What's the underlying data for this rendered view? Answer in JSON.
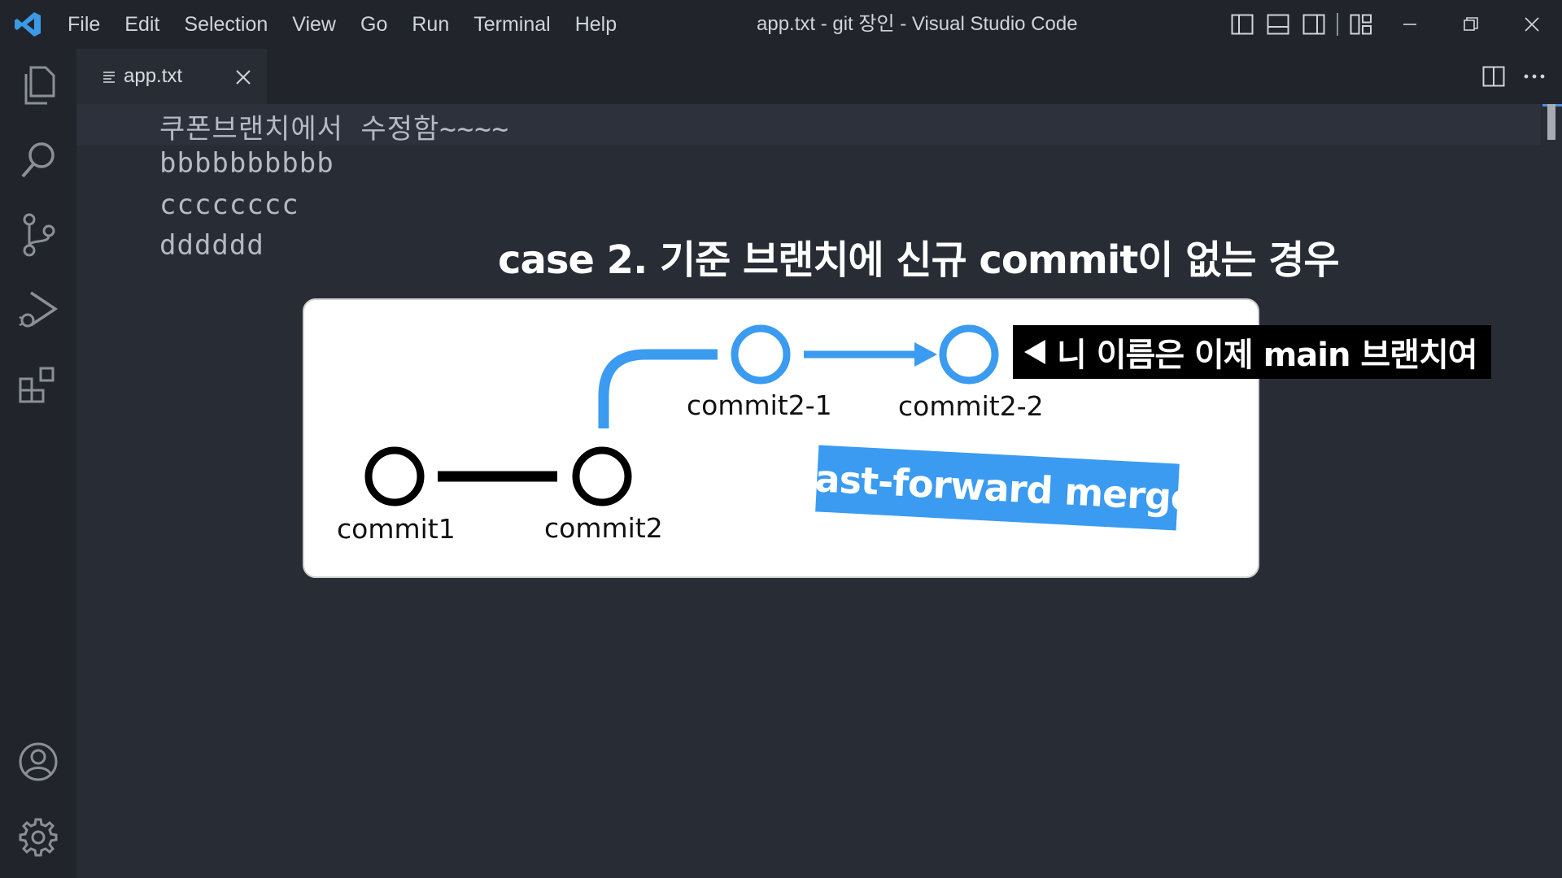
{
  "window": {
    "title": "app.txt - git 장인 - Visual Studio Code",
    "menu": [
      "File",
      "Edit",
      "Selection",
      "View",
      "Go",
      "Run",
      "Terminal",
      "Help"
    ]
  },
  "activity_bar": {
    "items": [
      "explorer-icon",
      "search-icon",
      "source-control-icon",
      "run-debug-icon",
      "extensions-icon"
    ],
    "bottom": [
      "account-icon",
      "settings-gear-icon"
    ]
  },
  "tab": {
    "label": "app.txt",
    "icon": "lines-icon"
  },
  "editor": {
    "lines": [
      "쿠폰브랜치에서  수정함~~~~",
      "bbbbbbbbbb",
      "cccccccc",
      "dddddd"
    ]
  },
  "overlay": {
    "caption": "case 2. 기준 브랜치에 신규 commit이 없는 경우",
    "callout": "니 이름은 이제 main 브랜치여",
    "badge": "fast-forward merge",
    "commits": [
      "commit1",
      "commit2",
      "commit2-1",
      "commit2-2"
    ]
  },
  "colors": {
    "accent_blue": "#3a9bf0",
    "editor_bg": "#282c34",
    "chrome_bg": "#21252b"
  }
}
